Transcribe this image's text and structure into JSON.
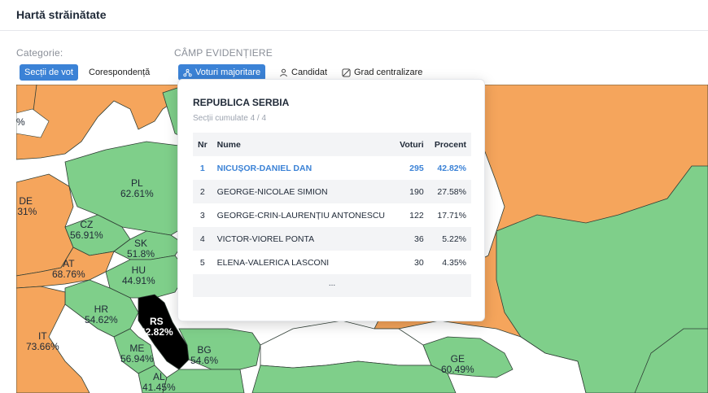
{
  "header": {
    "title": "Hartă străinătate"
  },
  "filters": {
    "category_label": "Categorie:",
    "category_options": [
      {
        "label": "Secții de vot",
        "active": true
      },
      {
        "label": "Corespondență",
        "active": false
      }
    ],
    "highlight_label": "CÂMP EVIDENȚIERE",
    "highlight_options": [
      {
        "label": "Voturi majoritare",
        "icon": "people-tree-icon",
        "active": true
      },
      {
        "label": "Candidat",
        "icon": "person-icon",
        "active": false
      },
      {
        "label": "Grad centralizare",
        "icon": "gauge-icon",
        "active": false
      }
    ]
  },
  "map": {
    "colors": {
      "green": "#7fcf8a",
      "orange": "#f5a55c",
      "selected": "#000000",
      "border": "#2f3e35"
    },
    "countries": [
      {
        "code": "PL",
        "value": "62.61%"
      },
      {
        "code": "DE",
        "value": ".31%"
      },
      {
        "code": "CZ",
        "value": "56.91%"
      },
      {
        "code": "SK",
        "value": "51.8%"
      },
      {
        "code": "AT",
        "value": "68.76%"
      },
      {
        "code": "HU",
        "value": "44.91%"
      },
      {
        "code": "HR",
        "value": "54.62%"
      },
      {
        "code": "RS",
        "value": "42.82%"
      },
      {
        "code": "IT",
        "value": "73.66%"
      },
      {
        "code": "ME",
        "value": "56.94%"
      },
      {
        "code": "BG",
        "value": "54.6%"
      },
      {
        "code": "AL",
        "value": "41.45%"
      },
      {
        "code": "GE",
        "value": "60.49%"
      }
    ],
    "edge_fragment": "%"
  },
  "popup": {
    "title": "REPUBLICA SERBIA",
    "subtitle": "Secții cumulate 4 / 4",
    "columns": [
      "Nr",
      "Nume",
      "Voturi",
      "Procent"
    ],
    "rows": [
      {
        "nr": "1",
        "name": "NICUȘOR-DANIEL DAN",
        "votes": "295",
        "pct": "42.82%"
      },
      {
        "nr": "2",
        "name": "GEORGE-NICOLAE SIMION",
        "votes": "190",
        "pct": "27.58%"
      },
      {
        "nr": "3",
        "name": "GEORGE-CRIN-LAURENȚIU ANTONESCU",
        "votes": "122",
        "pct": "17.71%"
      },
      {
        "nr": "4",
        "name": "VICTOR-VIOREL PONTA",
        "votes": "36",
        "pct": "5.22%"
      },
      {
        "nr": "5",
        "name": "ELENA-VALERICA LASCONI",
        "votes": "30",
        "pct": "4.35%"
      }
    ],
    "more": "..."
  }
}
